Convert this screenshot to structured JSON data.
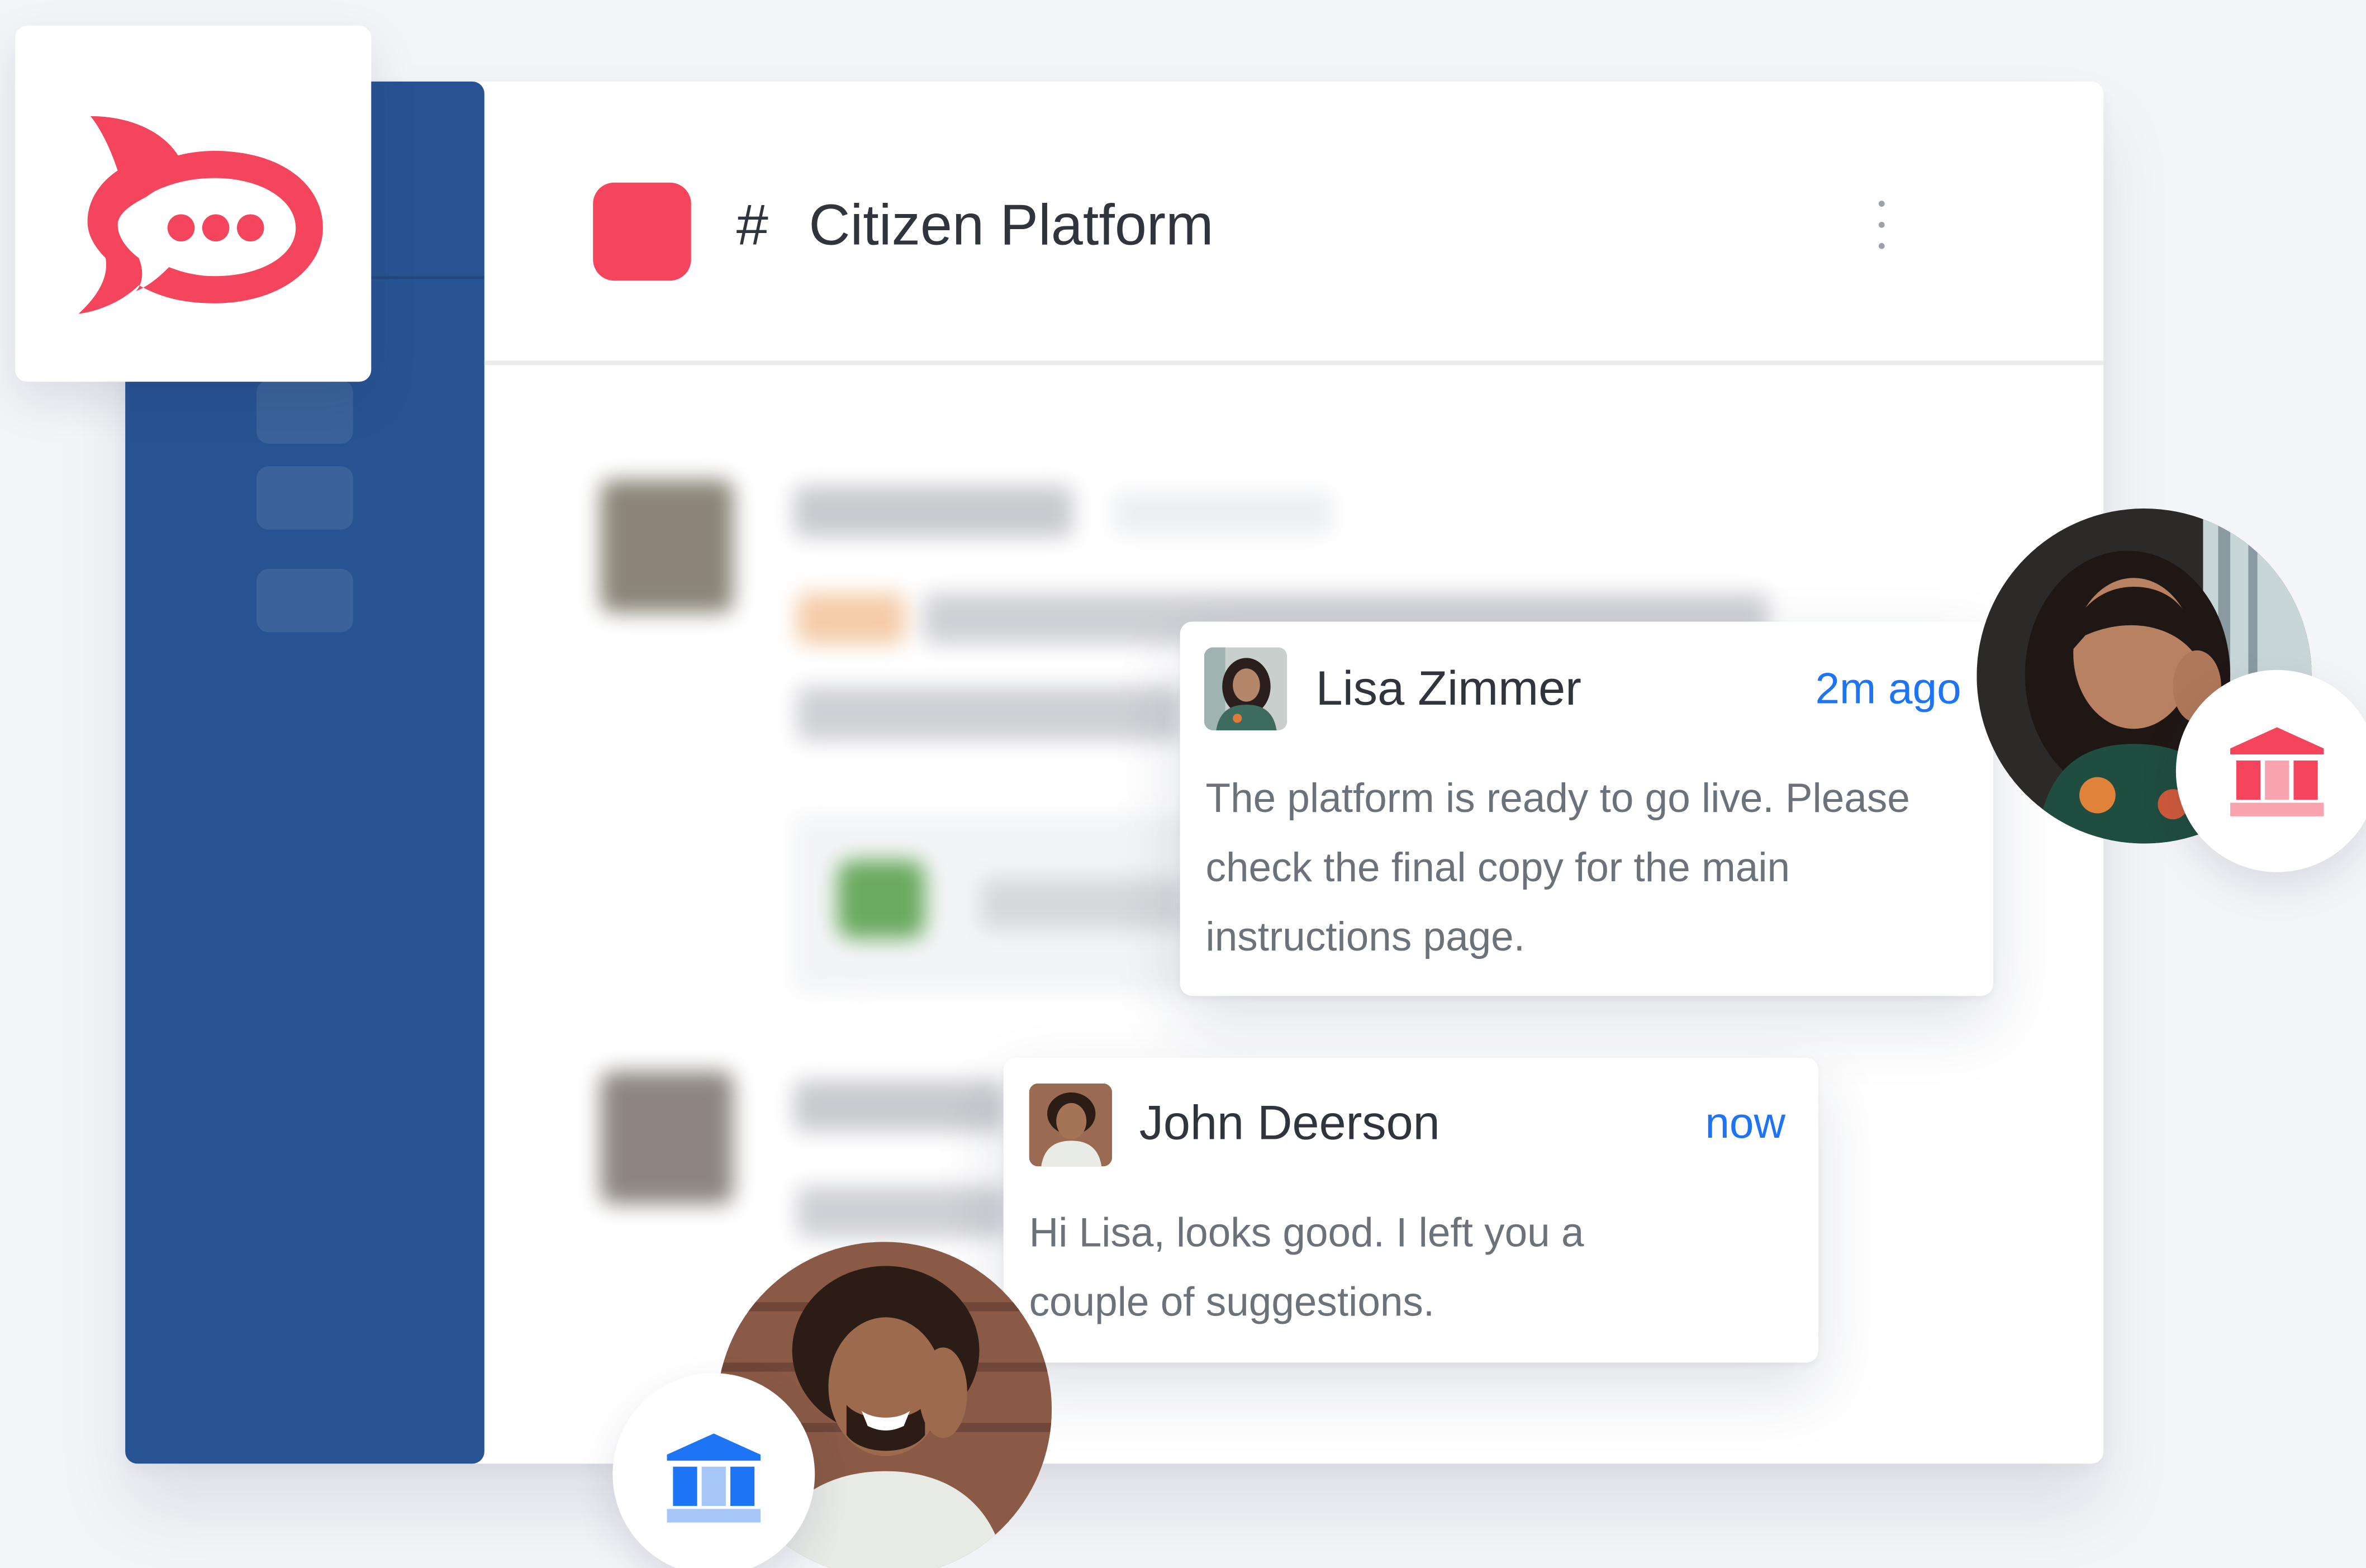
{
  "app": {
    "logo_icon": "rocket-chat-logo",
    "brand_color": "#f5455c",
    "sidebar_color": "#285392"
  },
  "header": {
    "channel_prefix": "#",
    "channel_name": "Citizen Platform",
    "menu_icon": "kebab-menu-icon"
  },
  "notifications": [
    {
      "author": "Lisa Zimmer",
      "time": "2m ago",
      "message": "The platform is ready to go live. Please check the final copy for the main instructions page.",
      "badge_icon": "government-building-icon",
      "badge_color": "#f5455c"
    },
    {
      "author": "John Deerson",
      "time": "now",
      "message": "Hi Lisa, looks good. I left you a couple of suggestions.",
      "badge_icon": "government-building-icon",
      "badge_color": "#1d74f5"
    }
  ]
}
